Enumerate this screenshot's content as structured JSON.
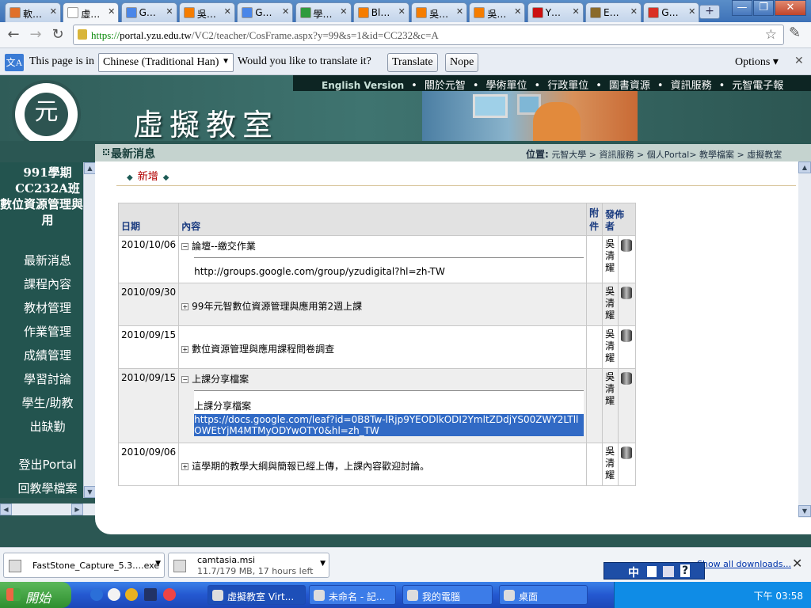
{
  "browser": {
    "tabs": [
      {
        "label": "軟…",
        "color": "#e0702a"
      },
      {
        "label": "虛…",
        "color": "#ffffff"
      },
      {
        "label": "G…",
        "color": "#4a86e8"
      },
      {
        "label": "吳…",
        "color": "#f57d00"
      },
      {
        "label": "G…",
        "color": "#4a86e8"
      },
      {
        "label": "學…",
        "color": "#2e9b3d"
      },
      {
        "label": "Bl…",
        "color": "#f57d00"
      },
      {
        "label": "吳…",
        "color": "#f57d00"
      },
      {
        "label": "吳…",
        "color": "#f57d00"
      },
      {
        "label": "Y…",
        "color": "#cc1111"
      },
      {
        "label": "E…",
        "color": "#8a6a2a"
      },
      {
        "label": "G…",
        "color": "#d93025"
      }
    ],
    "newtab": "+",
    "url_https": "https://",
    "url_host": "portal.yzu.edu.tw",
    "url_path": "/VC2/teacher/CosFrame.aspx?y=99&s=1&id=CC232&c=A",
    "window_controls": [
      "—",
      "❐",
      "✕"
    ]
  },
  "translate": {
    "prefix": "This page is in",
    "language": "Chinese (Traditional Han)",
    "question": "Would you like to translate it?",
    "translate_btn": "Translate",
    "nope_btn": "Nope",
    "options": "Options ▾",
    "close": "✕",
    "icon": "文A"
  },
  "site": {
    "topnav": [
      "English Version",
      "關於元智",
      "學術單位",
      "行政單位",
      "圖書資源",
      "資訊服務",
      "元智電子報"
    ],
    "logo_text": "元",
    "title": "虛擬教室"
  },
  "sidebar": {
    "course_title": "991學期 CC232A班 數位資源管理與應用",
    "items": [
      "最新消息",
      "課程內容",
      "教材管理",
      "作業管理",
      "成績管理",
      "學習討論",
      "學生/助教",
      "出缺勤"
    ],
    "bottom_items": [
      "登出Portal",
      "回教學檔案"
    ]
  },
  "content": {
    "section_title": "最新消息",
    "breadcrumb_label": "位置:",
    "breadcrumb": "元智大學 > 資訊服務 > 個人Portal> 教學檔案 > 虛擬教室",
    "add_link": "新增",
    "table_headers": {
      "date": "日期",
      "content": "內容",
      "attach": "附件",
      "author": "發佈者"
    },
    "rows": [
      {
        "date": "2010/10/06",
        "expanded": true,
        "title": "論壇--繳交作業",
        "body": "",
        "link": "http://groups.google.com/group/yzudigital?hl=zh-TW",
        "author": "吳清耀"
      },
      {
        "date": "2010/09/30",
        "expanded": false,
        "title": "99年元智數位資源管理與應用第2週上課",
        "body": "",
        "link": "",
        "author": "吳清耀"
      },
      {
        "date": "2010/09/15",
        "expanded": false,
        "title": "數位資源管理與應用課程問卷調查",
        "body": "",
        "link": "",
        "author": "吳清耀"
      },
      {
        "date": "2010/09/15",
        "expanded": true,
        "title": "上課分享檔案",
        "body": "上課分享檔案",
        "link": "https://docs.google.com/leaf?id=0B8Tw-lRjp9YEODlkODI2YmltZDdjYS00ZWY2LTllOWEtYjM4MTMyODYwOTY0&hl=zh_TW",
        "author": "吳清耀"
      },
      {
        "date": "2010/09/06",
        "expanded": false,
        "title": "這學期的教學大綱與簡報已經上傳，上課內容歡迎討論。",
        "body": "",
        "link": "",
        "author": "吳清耀"
      }
    ]
  },
  "downloads": {
    "items": [
      {
        "name": "FastStone_Capture_5.3….exe",
        "status": ""
      },
      {
        "name": "camtasia.msi",
        "status": "11.7/179 MB, 17 hours left"
      }
    ],
    "show_all": "Show all downloads...",
    "close": "✕"
  },
  "ime": {
    "mode": "中"
  },
  "taskbar": {
    "start": "開始",
    "windows": [
      "虛擬教室 Virt...",
      "未命名 - 記...",
      "我的電腦",
      "桌面"
    ],
    "clock": "下午 03:58"
  }
}
